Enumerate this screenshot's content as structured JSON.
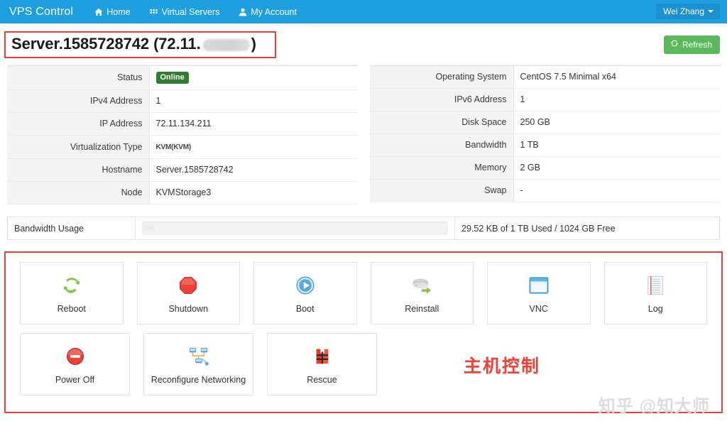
{
  "navbar": {
    "brand": "VPS Control",
    "items": [
      {
        "label": "Home",
        "icon": "home-icon"
      },
      {
        "label": "Virtual Servers",
        "icon": "grid-icon"
      },
      {
        "label": "My Account",
        "icon": "user-icon"
      }
    ],
    "user": {
      "label": "Wei Zhang",
      "icon": "chevron-down-icon"
    }
  },
  "header": {
    "title_prefix": "Server.1585728742 (72.11.",
    "title_suffix": ")",
    "redacted": true,
    "refresh_label": "Refresh"
  },
  "info_left": {
    "rows": [
      {
        "label": "Status",
        "value": "Online",
        "type": "badge"
      },
      {
        "label": "IPv4 Address",
        "value": "1",
        "type": "text"
      },
      {
        "label": "IP Address",
        "value": "72.11.134.211",
        "type": "text"
      },
      {
        "label": "Virtualization Type",
        "value": "KVM(KVM)",
        "type": "kvm"
      },
      {
        "label": "Hostname",
        "value": "Server.1585728742",
        "type": "text"
      },
      {
        "label": "Node",
        "value": "KVMStorage3",
        "type": "text"
      }
    ]
  },
  "info_right": {
    "rows": [
      {
        "label": "Operating System",
        "value": "CentOS 7.5 Minimal x64"
      },
      {
        "label": "IPv6 Address",
        "value": "1"
      },
      {
        "label": "Disk Space",
        "value": "250 GB"
      },
      {
        "label": "Bandwidth",
        "value": "1 TB"
      },
      {
        "label": "Memory",
        "value": "2 GB"
      },
      {
        "label": "Swap",
        "value": "-"
      }
    ]
  },
  "bandwidth": {
    "label": "Bandwidth Usage",
    "progress_label": "0%",
    "progress_percent": 0,
    "summary": "29.52 KB of 1 TB Used / 1024 GB Free"
  },
  "actions": {
    "row1": [
      {
        "label": "Reboot",
        "icon": "refresh-arrows-icon"
      },
      {
        "label": "Shutdown",
        "icon": "stop-octagon-icon"
      },
      {
        "label": "Boot",
        "icon": "play-circle-icon"
      },
      {
        "label": "Reinstall",
        "icon": "server-arrow-icon"
      },
      {
        "label": "VNC",
        "icon": "window-icon"
      },
      {
        "label": "Log",
        "icon": "notepad-icon"
      }
    ],
    "row2": [
      {
        "label": "Power Off",
        "icon": "power-minus-icon"
      },
      {
        "label": "Reconfigure Networking",
        "icon": "network-icon"
      },
      {
        "label": "Rescue",
        "icon": "life-vest-icon"
      }
    ],
    "annotation": "主机控制"
  },
  "watermark": "知乎 @知大师",
  "colors": {
    "navbar": "#1e9fe0",
    "accent_red": "#e8403a",
    "success_green": "#5cb85c",
    "badge_green": "#2e7d32",
    "annotation_red": "#ef4136"
  }
}
